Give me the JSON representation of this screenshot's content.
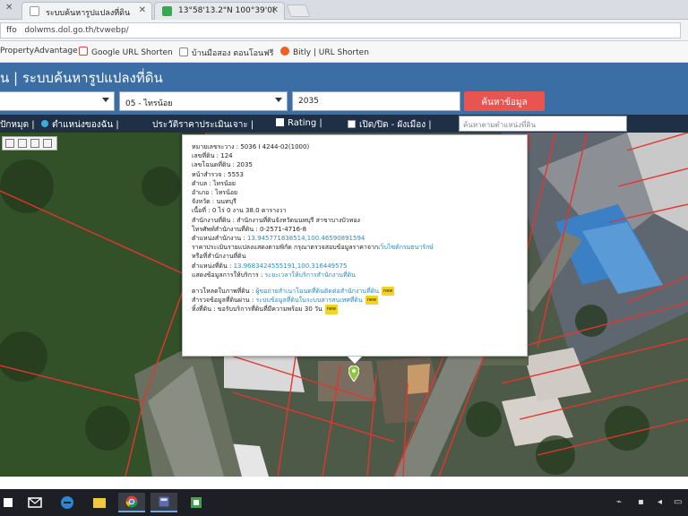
{
  "browser": {
    "tabs": [
      {
        "label": "ระบบค้นหารูปแปลงที่ดิน",
        "active": true
      },
      {
        "label": "13°58'13.2\"N 100°39'0(",
        "active": false
      }
    ],
    "address": "dolwms.dol.go.th/tvwebp/",
    "address_prefix": "ffo",
    "bookmarks": [
      {
        "label": "PropertyAdvantage",
        "icon": "house-icon"
      },
      {
        "label": "Google URL Shorten",
        "icon": "google-icon"
      },
      {
        "label": "บ้านมือสอง ตอนโอนฟรี",
        "icon": "page-icon"
      },
      {
        "label": "Bitly | URL Shorten",
        "icon": "bitly-icon"
      }
    ]
  },
  "app": {
    "title": "น | ระบบค้นหารูปแปลงที่ดิน",
    "province_value": "",
    "district_value": "05 - ไทรน้อย",
    "parcel_value": "2035",
    "search_label": "ค้นหาข้อมูล",
    "toolbar": {
      "locate": "ปักหมุด",
      "my_location": "ตำแหน่งของฉัน",
      "price_history": "ประวัติราคาประเมินเจาะ",
      "rating": "Rating",
      "toggle_layer": "เปิด/ปิด - ผังเมือง",
      "search_placeholder": "ค้นหาตามตำแหน่งที่ดิน"
    }
  },
  "popup": {
    "rows": [
      {
        "label": "หมายเลขระวาง",
        "value": "5036 I 4244-02(1000)"
      },
      {
        "label": "เลขที่ดิน",
        "value": "124"
      },
      {
        "label": "เลขโฉนดที่ดิน",
        "value": "2035"
      },
      {
        "label": "หน้าสำรวจ",
        "value": "5553"
      },
      {
        "label": "ตำบล",
        "value": "ไทรน้อย"
      },
      {
        "label": "อำเภอ",
        "value": "ไทรน้อย"
      },
      {
        "label": "จังหวัด",
        "value": "นนทบุรี"
      },
      {
        "label": "เนื้อที่",
        "value": "0 ไร่ 0 งาน 38.0 ตารางวา"
      },
      {
        "label": "สำนักงานที่ดิน",
        "value": "สำนักงานที่ดินจังหวัดนนทบุรี สาขาบางบัวทอง"
      },
      {
        "label": "โทรศัพท์สำนักงานที่ดิน",
        "value": "0-2571-4716-8"
      },
      {
        "label": "ตำแหน่งสำนักงาน",
        "value": "13.945771838514,100.46590891594",
        "link": true
      }
    ],
    "note1": "ราคาประเมินรายแปลงแสดงตามพิกัด   กรุณาตรวจสอบข้อมูลราคาจาก",
    "note1_link": "เว็บไซต์กรมธนารักษ์",
    "note2": "หรือที่สำนักงานที่ดิน",
    "coord_label": "ตำแหน่งที่ดิน",
    "coord_value": "13.9683424555191,100.316449575",
    "service_label": "แสดงข้อมูลการให้บริการ",
    "service_link": "ระยะเวลาให้บริการสำนักงานที่ดิน",
    "extra": [
      {
        "label": "ดาวโหลดใบภาพที่ดิน",
        "link": "ผู้ขอถ่ายสำเนาโฉนดที่ดินติดต่อสำนักงานที่ดิน",
        "new": "new"
      },
      {
        "label": "สำรวจข้อมูลที่ดินผ่าน",
        "link": "ระบบข้อมูลที่ดินในระบบสารสนเทศที่ดิน",
        "new": "new"
      },
      {
        "label": "หิ้งที่ดิน",
        "link": "ขอรับบริการที่ดินที่มีความพร้อม 30 วัน",
        "new": "new"
      }
    ]
  },
  "taskbar": {
    "apps": [
      "start-icon",
      "mail-icon",
      "edge-icon",
      "explorer-icon",
      "chrome-icon",
      "calculator-icon",
      "app-green-icon"
    ]
  },
  "colors": {
    "header_blue": "#3a6ea5",
    "toolbar_dark": "#1f2f45",
    "search_red": "#e8544f",
    "link_blue": "#2a8bc4",
    "parcel_line": "#e5342f"
  }
}
